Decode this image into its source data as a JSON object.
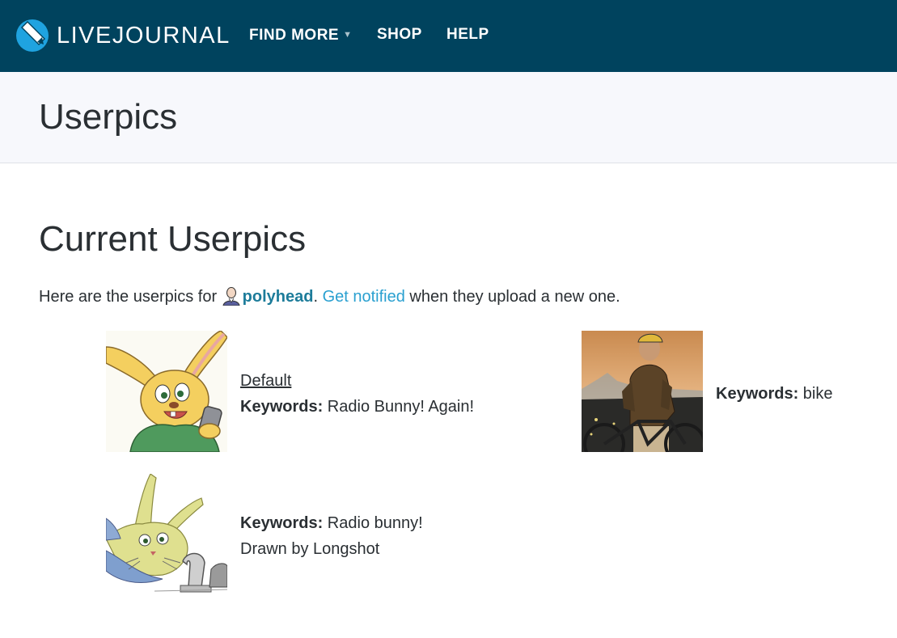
{
  "brand": {
    "name": "LIVEJOURNAL",
    "logo_icon": "livejournal-pencil-icon"
  },
  "nav": {
    "find_more": "FIND MORE",
    "shop": "SHOP",
    "help": "HELP",
    "caret_icon": "caret-down-icon"
  },
  "page": {
    "title": "Userpics"
  },
  "main": {
    "section_title": "Current Userpics",
    "intro": {
      "before": "Here are the userpics for ",
      "username": "polyhead",
      "after_user": ". ",
      "notify_link": "Get notified",
      "after_link": " when they upload a new one."
    },
    "userpics": [
      {
        "default_label": "Default",
        "keywords_label": "Keywords:",
        "keywords": " Radio Bunny! Again!",
        "image": "cartoon-bunny-phone"
      },
      {
        "keywords_label": "Keywords:",
        "keywords": " bike",
        "image": "cyclist-photo"
      },
      {
        "keywords_label": "Keywords:",
        "keywords": " Radio bunny!",
        "description": "Drawn by Longshot",
        "image": "sketch-bunny-faucet"
      }
    ]
  },
  "colors": {
    "topbar": "#00435e",
    "logo_accent": "#1fa3e0",
    "link": "#1d7c9a",
    "notify_link": "#2aa0d0",
    "header_bg": "#f7f8fc"
  }
}
